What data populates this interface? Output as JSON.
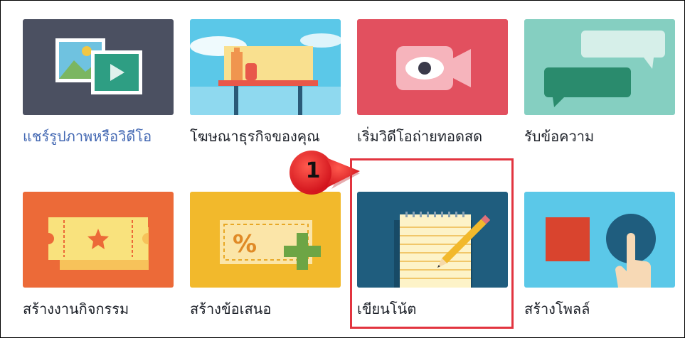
{
  "tiles": [
    {
      "label": "แชร์รูปภาพหรือวิดีโอ",
      "bg": "#4b5061"
    },
    {
      "label": "โฆษณาธุรกิจของคุณ",
      "bg": "#5bc8e8"
    },
    {
      "label": "เริ่มวิดีโอถ่ายทอดสด",
      "bg": "#e2505f"
    },
    {
      "label": "รับข้อความ",
      "bg": "#85cfc1"
    },
    {
      "label": "สร้างงานกิจกรรม",
      "bg": "#ec6a38"
    },
    {
      "label": "สร้างข้อเสนอ",
      "bg": "#f2b92c"
    },
    {
      "label": "เขียนโน้ต",
      "bg": "#1f5d7e"
    },
    {
      "label": "สร้างโพลล์",
      "bg": "#5bc8e8"
    }
  ],
  "callout": {
    "number": "1"
  },
  "highlight_color": "#e2343f"
}
